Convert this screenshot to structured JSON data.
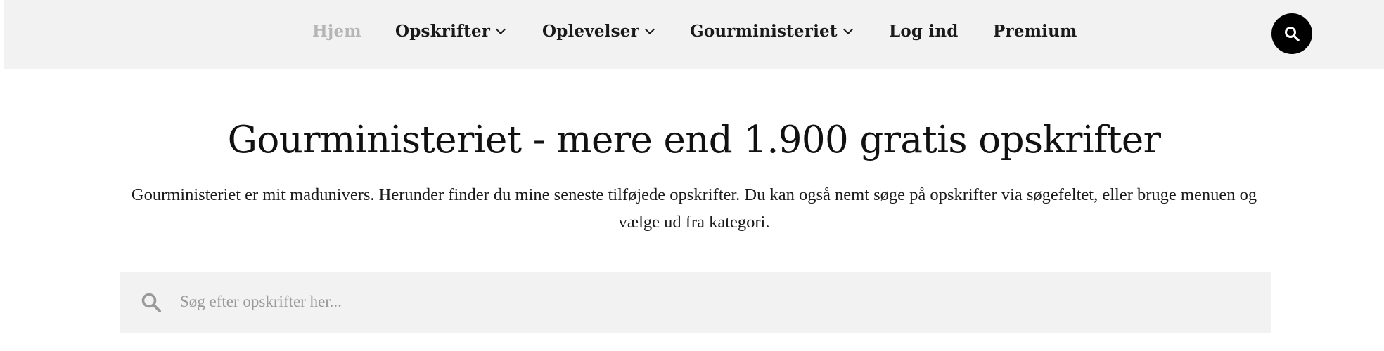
{
  "nav": {
    "items": [
      {
        "label": "Hjem",
        "active": true,
        "dropdown": false
      },
      {
        "label": "Opskrifter",
        "active": false,
        "dropdown": true
      },
      {
        "label": "Oplevelser",
        "active": false,
        "dropdown": true
      },
      {
        "label": "Gourministeriet",
        "active": false,
        "dropdown": true
      },
      {
        "label": "Log ind",
        "active": false,
        "dropdown": false
      },
      {
        "label": "Premium",
        "active": false,
        "dropdown": false
      }
    ],
    "search_icon": "search-icon"
  },
  "hero": {
    "title": "Gourministeriet - mere end 1.900 gratis opskrifter",
    "intro": "Gourministeriet er mit madunivers. Herunder finder du mine seneste tilføjede opskrifter. Du kan også nemt søge på opskrifter via søgefeltet, eller bruge menuen og vælge ud fra kategori."
  },
  "search": {
    "placeholder": "Søg efter opskrifter her...",
    "value": "",
    "icon": "search-icon"
  },
  "colors": {
    "topbar_bg": "#f2f2f3",
    "active_nav": "#b5b5b5",
    "text": "#1a1a1a",
    "search_button_bg": "#000000"
  }
}
